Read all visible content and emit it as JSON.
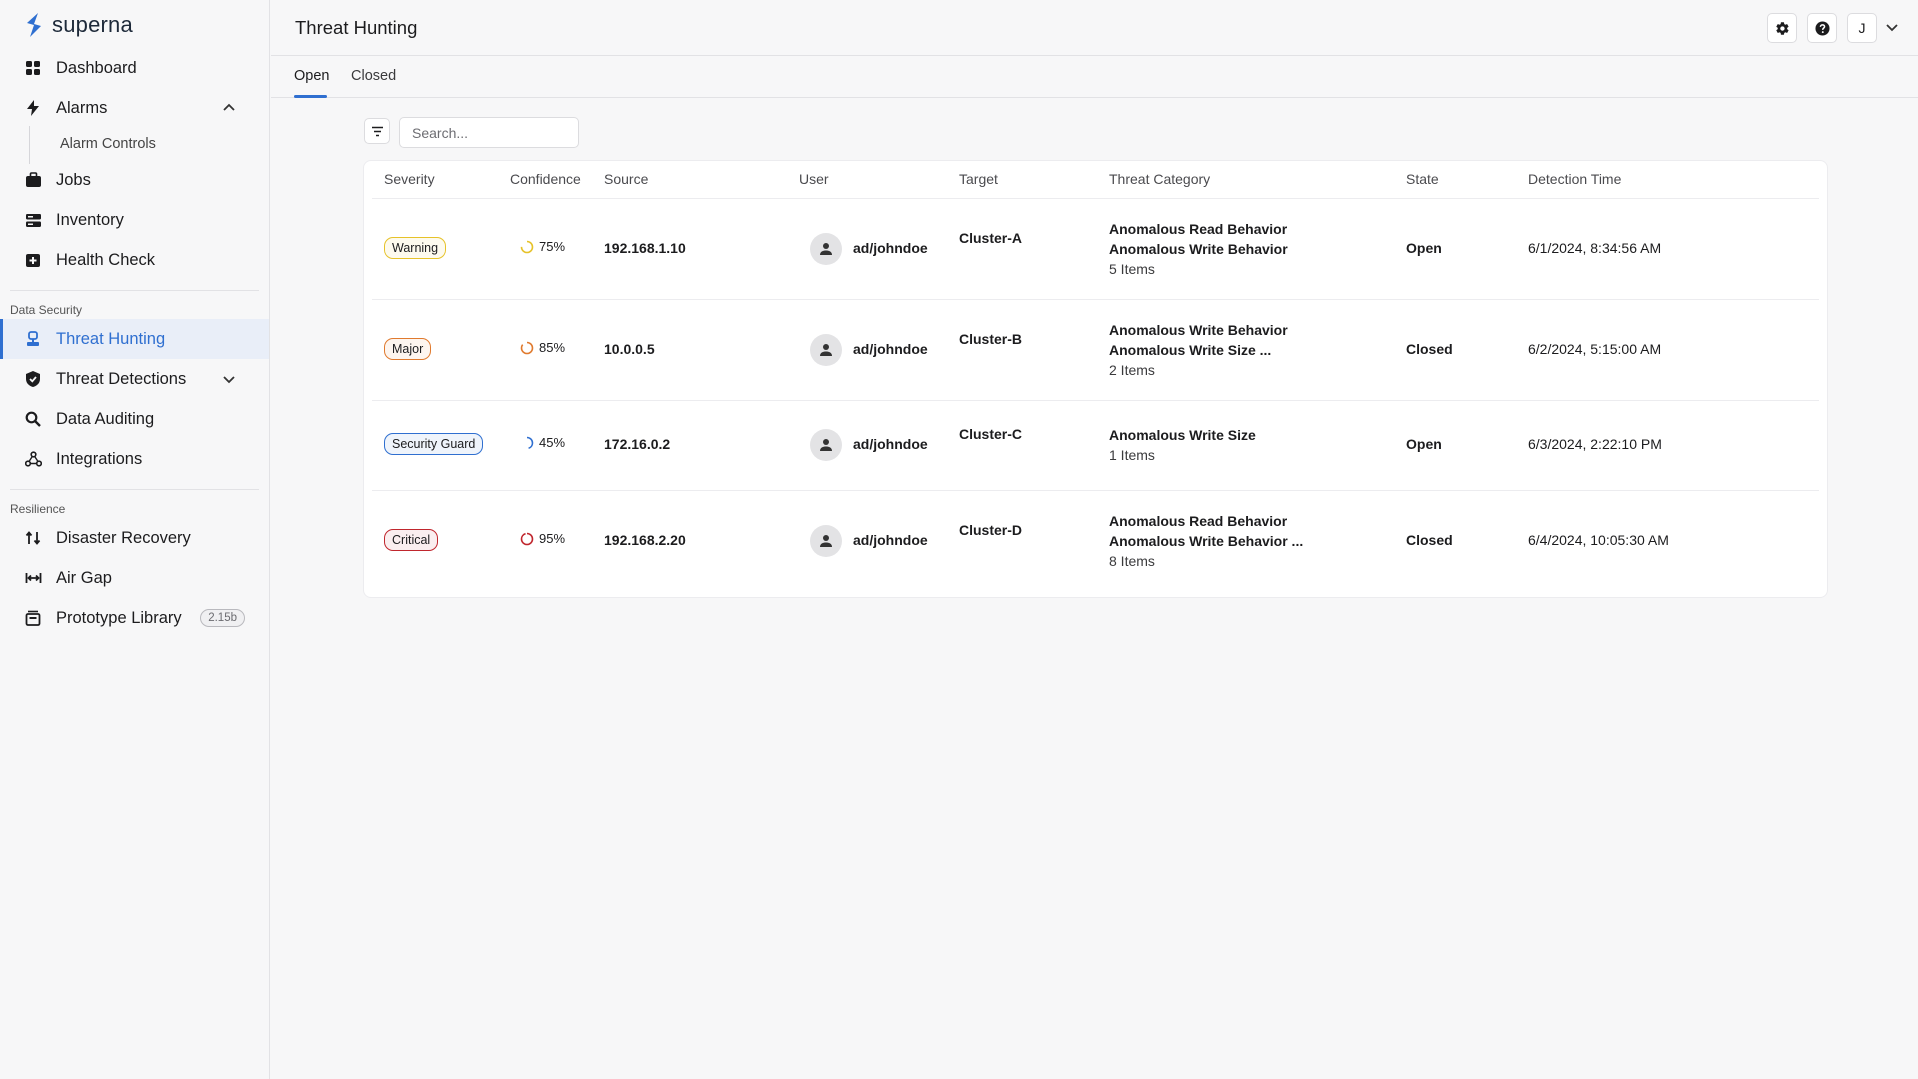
{
  "app": {
    "name": "superna",
    "brand_color": "#2f6fd0"
  },
  "sidebar": {
    "items": [
      {
        "label": "Dashboard",
        "icon": "dashboard-icon"
      },
      {
        "label": "Alarms",
        "icon": "bolt-icon",
        "expanded": true,
        "children": [
          {
            "label": "Alarm Controls"
          }
        ]
      },
      {
        "label": "Jobs",
        "icon": "briefcase-icon"
      },
      {
        "label": "Inventory",
        "icon": "inventory-icon"
      },
      {
        "label": "Health Check",
        "icon": "medical-icon"
      }
    ],
    "sections": [
      {
        "title": "Data Security",
        "items": [
          {
            "label": "Threat Hunting",
            "icon": "threat-hunting-icon",
            "active": true
          },
          {
            "label": "Threat Detections",
            "icon": "shield-icon",
            "expanded": false
          },
          {
            "label": "Data Auditing",
            "icon": "search-magnify-icon"
          },
          {
            "label": "Integrations",
            "icon": "integrations-icon"
          }
        ]
      },
      {
        "title": "Resilience",
        "items": [
          {
            "label": "Disaster Recovery",
            "icon": "swap-icon"
          },
          {
            "label": "Air Gap",
            "icon": "air-gap-icon"
          },
          {
            "label": "Prototype Library",
            "icon": "library-icon",
            "badge": "2.15b"
          }
        ]
      }
    ]
  },
  "header": {
    "title": "Threat Hunting",
    "settings_icon": "gear-icon",
    "help_icon": "help-icon",
    "user_initial": "J"
  },
  "tabs": [
    {
      "label": "Open",
      "active": true
    },
    {
      "label": "Closed",
      "active": false
    }
  ],
  "search": {
    "placeholder": "Search..."
  },
  "table": {
    "columns": [
      "Severity",
      "Confidence",
      "Source",
      "User",
      "Target",
      "Threat Category",
      "State",
      "Detection Time"
    ],
    "rows": [
      {
        "severity": "Warning",
        "severity_color": "#e6c229",
        "confidence": "75%",
        "confidence_value": 0.75,
        "source": "192.168.1.10",
        "user": "ad/johndoe",
        "target": "Cluster-A",
        "categories": [
          "Anomalous Read Behavior",
          "Anomalous Write Behavior"
        ],
        "items": "5 Items",
        "state": "Open",
        "time": "6/1/2024, 8:34:56 AM"
      },
      {
        "severity": "Major",
        "severity_color": "#e07a2e",
        "confidence": "85%",
        "confidence_value": 0.85,
        "source": "10.0.0.5",
        "user": "ad/johndoe",
        "target": "Cluster-B",
        "categories": [
          "Anomalous Write Behavior",
          "Anomalous Write Size ..."
        ],
        "items": "2 Items",
        "state": "Closed",
        "time": "6/2/2024, 5:15:00 AM"
      },
      {
        "severity": "Security Guard",
        "severity_color": "#2f6fd0",
        "confidence": "45%",
        "confidence_value": 0.45,
        "source": "172.16.0.2",
        "user": "ad/johndoe",
        "target": "Cluster-C",
        "categories": [
          "Anomalous Write Size"
        ],
        "items": "1 Items",
        "state": "Open",
        "time": "6/3/2024, 2:22:10 PM"
      },
      {
        "severity": "Critical",
        "severity_color": "#c0262d",
        "confidence": "95%",
        "confidence_value": 0.95,
        "source": "192.168.2.20",
        "user": "ad/johndoe",
        "target": "Cluster-D",
        "categories": [
          "Anomalous Read Behavior",
          "Anomalous Write Behavior ..."
        ],
        "items": "8 Items",
        "state": "Closed",
        "time": "6/4/2024, 10:05:30 AM"
      }
    ]
  }
}
